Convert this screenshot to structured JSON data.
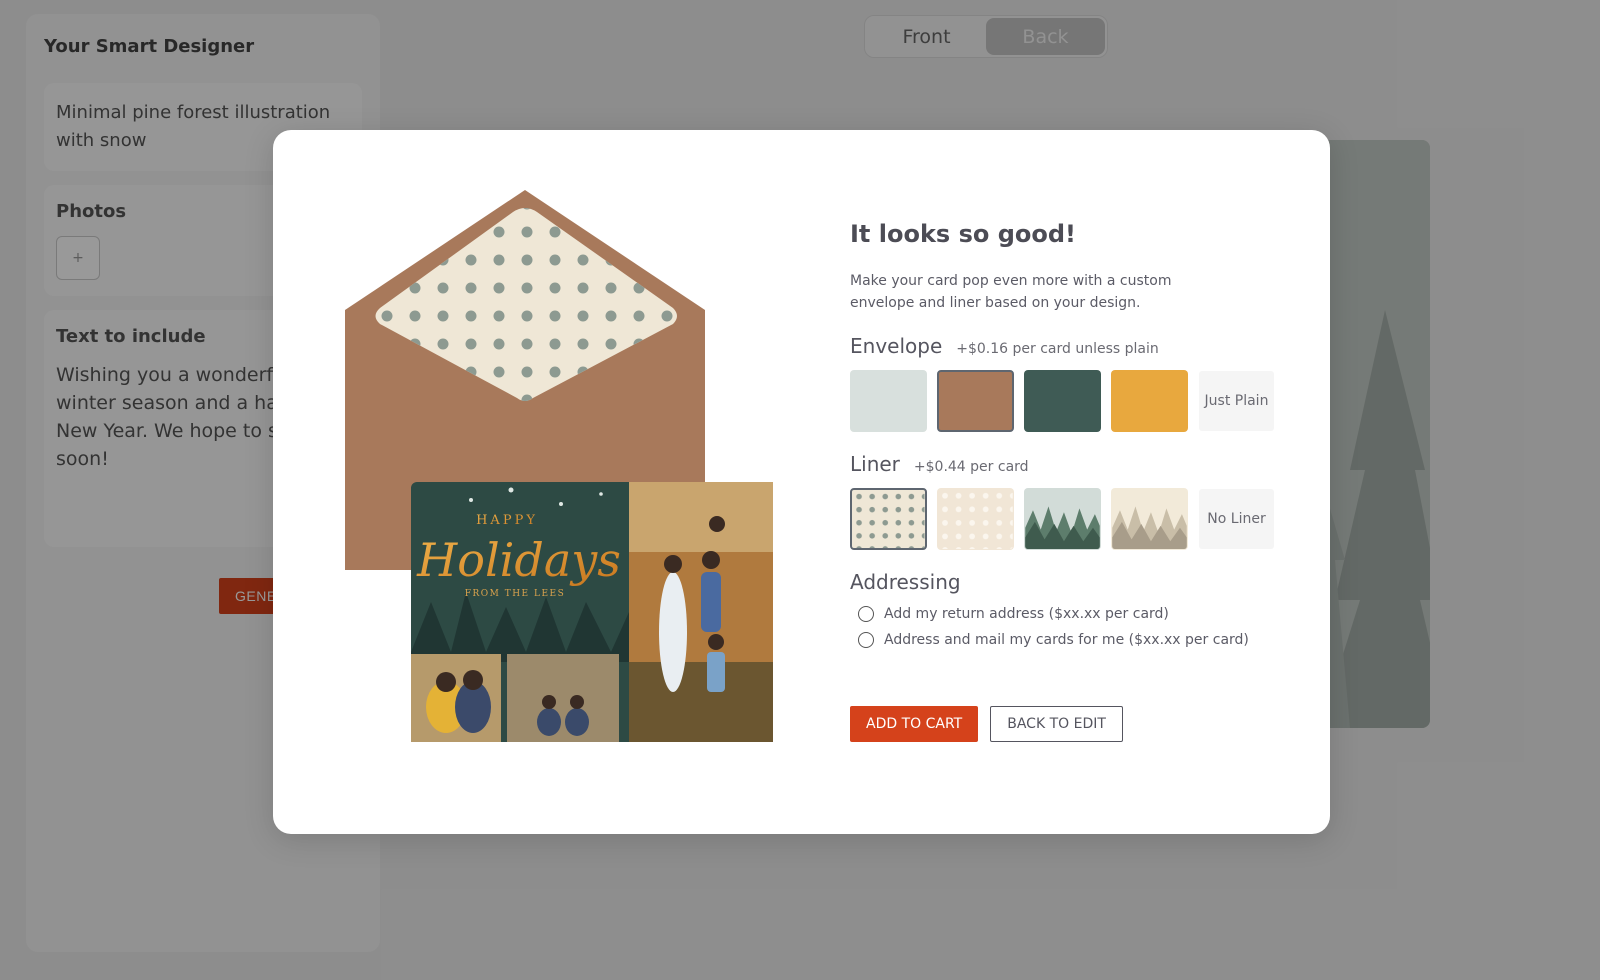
{
  "app": {
    "sidebar": {
      "title": "Your Smart Designer",
      "prompt_text": "Minimal pine forest illustration with snow",
      "photos_title": "Photos",
      "add_photo_label": "+",
      "text_title": "Text to include",
      "text_body": "Wishing you a wonderful winter season and a happy New Year. We hope to see you soon!",
      "generate_label": "GENERATE"
    },
    "view_toggle": {
      "front": "Front",
      "back": "Back",
      "active": "back"
    }
  },
  "modal": {
    "heading": "It looks so good!",
    "description": "Make your card pop even more with a custom envelope and liner based on your design.",
    "envelope": {
      "title": "Envelope",
      "price_note": "+$0.16 per card unless plain",
      "options": [
        {
          "color": "#d8e0dd"
        },
        {
          "color": "#a8795b",
          "selected": true
        },
        {
          "color": "#3f5b55"
        },
        {
          "color": "#e8a83e"
        },
        {
          "label": "Just Plain"
        }
      ]
    },
    "liner": {
      "title": "Liner",
      "price_note": "+$0.44 per card",
      "options": [
        {
          "pattern": "polka-dots-sage",
          "selected": true
        },
        {
          "pattern": "polka-dots-cream"
        },
        {
          "pattern": "pine-forest-green"
        },
        {
          "pattern": "pine-forest-beige"
        },
        {
          "label": "No Liner"
        }
      ]
    },
    "addressing": {
      "title": "Addressing",
      "options": [
        "Add my return address ($xx.xx per card)",
        "Address and mail my cards for me ($xx.xx per card)"
      ]
    },
    "card_preview": {
      "headline_top": "HAPPY",
      "headline_script": "Holidays",
      "signature": "FROM THE LEES"
    },
    "buttons": {
      "add_to_cart": "ADD TO CART",
      "back_to_edit": "BACK TO EDIT"
    },
    "colors": {
      "accent": "#d5421b",
      "envelope": "#a8795b",
      "liner_bg": "#efe7d6",
      "liner_dot": "#8d9a91",
      "card_green": "#2d4a44",
      "gold": "#d99533"
    }
  }
}
